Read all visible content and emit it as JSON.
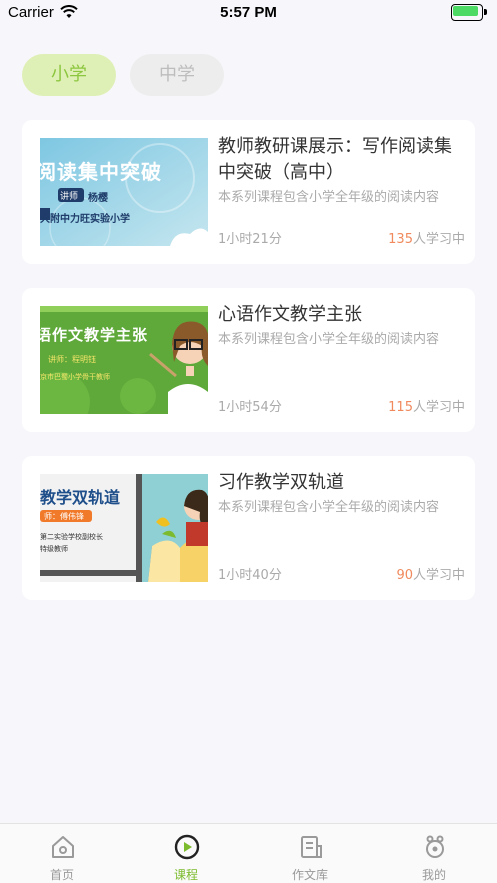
{
  "status_bar": {
    "carrier": "Carrier",
    "time": "5:57 PM"
  },
  "level_tabs": [
    {
      "label": "小学",
      "active": true
    },
    {
      "label": "中学",
      "active": false
    }
  ],
  "courses": [
    {
      "title": "教师教研课展示：写作阅读集中突破（高中）",
      "description": "本系列课程包含小学全年级的阅读内容",
      "duration": "1小时21分",
      "learners": "135",
      "learners_suffix": "人学习中",
      "thumb": {
        "headline": "阅读集中突破",
        "tag": "讲师",
        "teacher": "杨樱",
        "school": "大附中力旺实验小学"
      }
    },
    {
      "title": "心语作文教学主张",
      "description": "本系列课程包含小学全年级的阅读内容",
      "duration": "1小时54分",
      "learners": "115",
      "learners_suffix": "人学习中",
      "thumb": {
        "headline": "语作文教学主张",
        "teacher": "讲师：程明钰",
        "school": "京市巴蜀小学骨干教师"
      }
    },
    {
      "title": "习作教学双轨道",
      "description": "本系列课程包含小学全年级的阅读内容",
      "duration": "1小时40分",
      "learners": "90",
      "learners_suffix": "人学习中",
      "thumb": {
        "headline": "教学双轨道",
        "teacher": "师：傅伟锋",
        "school": "第二实验学校副校长",
        "rank": "特级教师"
      }
    }
  ],
  "tabbar": [
    {
      "label": "首页",
      "icon": "home-icon",
      "active": false
    },
    {
      "label": "课程",
      "icon": "play-icon",
      "active": true
    },
    {
      "label": "作文库",
      "icon": "document-icon",
      "active": false
    },
    {
      "label": "我的",
      "icon": "profile-icon",
      "active": false
    }
  ],
  "colors": {
    "accent_green": "#8cc63e",
    "learners_orange": "#f08a5d",
    "background": "#f7f6fa"
  }
}
